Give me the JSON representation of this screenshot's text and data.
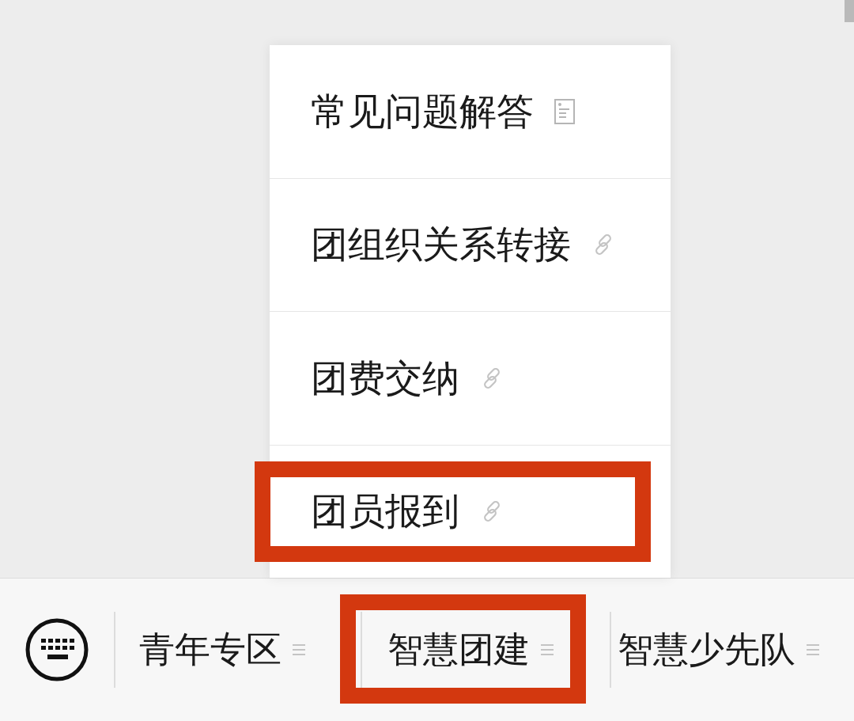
{
  "menu_popup": {
    "items": [
      {
        "label": "常见问题解答",
        "kind": "document",
        "highlighted": false
      },
      {
        "label": "团组织关系转接",
        "kind": "link",
        "highlighted": false
      },
      {
        "label": "团费交纳",
        "kind": "link",
        "highlighted": false
      },
      {
        "label": "团员报到",
        "kind": "link",
        "highlighted": true
      }
    ]
  },
  "bottom_menu": {
    "tabs": [
      {
        "label": "青年专区",
        "highlighted": false
      },
      {
        "label": "智慧团建",
        "highlighted": true
      },
      {
        "label": "智慧少先队",
        "highlighted": false
      }
    ]
  }
}
